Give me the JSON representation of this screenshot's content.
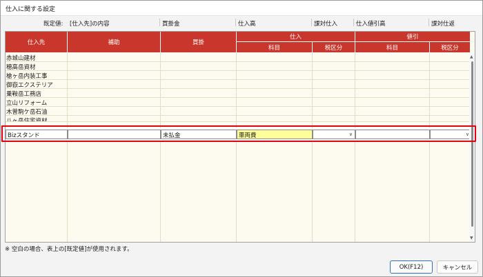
{
  "window": {
    "title": "仕入に関する設定"
  },
  "defaults": {
    "label": "既定値:",
    "supplier": "[仕入先]の内容",
    "debit": "買掛金",
    "account": "仕入高",
    "tax": "課対仕入",
    "discount_account": "仕入値引高",
    "discount_tax": "課対仕返"
  },
  "table": {
    "headers": {
      "supplier": "仕入先",
      "sub": "補助",
      "debit": "買掛",
      "purchase": "仕入",
      "purchase_item": "科目",
      "purchase_tax": "税区分",
      "discount": "値引",
      "discount_item": "科目",
      "discount_tax": "税区分"
    },
    "rows": [
      "赤城山建材",
      "穂高岳資材",
      "槍ヶ岳内装工事",
      "御嶽エクステリア",
      "乗鞍岳工務店",
      "立山リフォーム",
      "木曽駒ケ岳石油",
      "八ヶ岳住宅資材"
    ],
    "edit_row": {
      "supplier": "Bizスタンド",
      "sub": "",
      "debit": "未払金",
      "purchase_item": "車両費",
      "purchase_tax": "",
      "discount_item": "",
      "discount_tax": ""
    }
  },
  "footnote": "※ 空白の場合、表上の[既定値]が使用されます。",
  "buttons": {
    "ok": "OK(F12)",
    "cancel": "キャンセル"
  },
  "colors": {
    "header": "#c9372c",
    "highlight": "#e3000f",
    "active_cell": "#ffff99"
  }
}
